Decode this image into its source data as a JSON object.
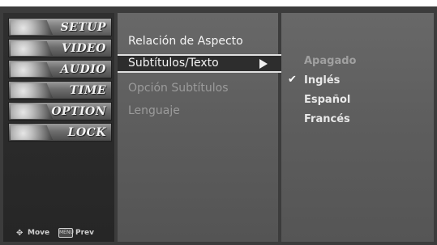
{
  "left_menu": {
    "items": [
      {
        "label": "SETUP",
        "icon": "setup-photo-icon"
      },
      {
        "label": "VIDEO",
        "icon": "video-photo-icon"
      },
      {
        "label": "AUDIO",
        "icon": "audio-photo-icon"
      },
      {
        "label": "TIME",
        "icon": "time-photo-icon"
      },
      {
        "label": "OPTION",
        "icon": "option-photo-icon"
      },
      {
        "label": "LOCK",
        "icon": "lock-photo-icon"
      }
    ],
    "footer": {
      "move_label": "Move",
      "menu_key": "MENU",
      "prev_label": "Prev"
    }
  },
  "mid_menu": {
    "items": [
      {
        "label": "Relación de Aspecto"
      },
      {
        "label": "Subtítulos/Texto"
      },
      {
        "label": "Opción Subtítulos"
      },
      {
        "label": "Lenguaje"
      }
    ]
  },
  "sub_menu": {
    "items": [
      {
        "label": "Apagado"
      },
      {
        "label": "Inglés"
      },
      {
        "label": "Español"
      },
      {
        "label": "Francés"
      }
    ],
    "selected_index": 1,
    "check_glyph": "✔"
  },
  "colors": {
    "background": "#3c3c3c",
    "panel": "#5d5d5d",
    "highlight": "#2d2d2d",
    "text": "#f4f4f4"
  }
}
